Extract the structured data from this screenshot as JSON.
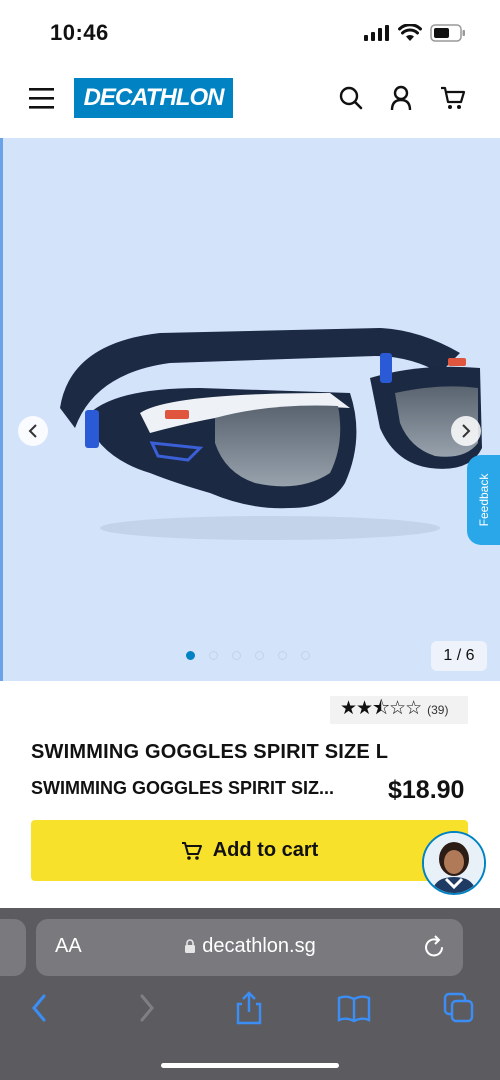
{
  "status_bar": {
    "time": "10:46"
  },
  "header": {
    "brand": "DECATHLON"
  },
  "gallery": {
    "counter": "1 / 6",
    "feedback_label": "Feedback",
    "current_image": 1,
    "total_images": 6
  },
  "product": {
    "rating_count": "(39)",
    "rating_stars": "★★⯪☆☆",
    "rating_value": 2.5,
    "title": "SWIMMING GOGGLES SPIRIT SIZE L",
    "subtitle": "SWIMMING GOGGLES SPIRIT SIZ...",
    "price": "$18.90",
    "add_to_cart": "Add to cart"
  },
  "browser": {
    "aa_label": "AA",
    "url": "decathlon.sg"
  },
  "colors": {
    "brand": "#0082c3",
    "cta": "#f8e12a",
    "hero_bg": "#d3e3fa",
    "feedback": "#2aa7e8",
    "safari_bar": "#5c5c60"
  }
}
